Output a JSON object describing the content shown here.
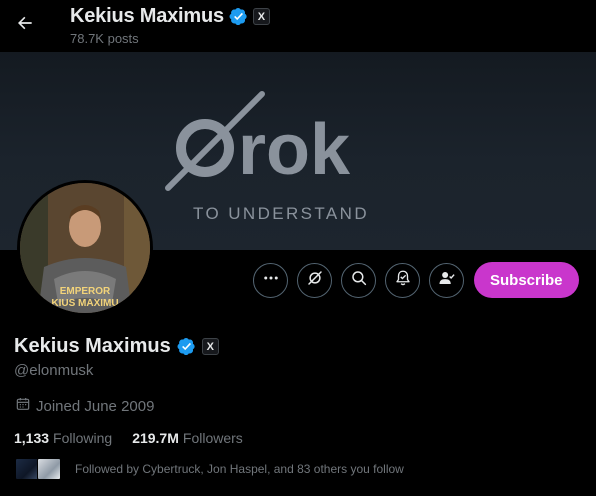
{
  "header": {
    "name": "Kekius Maximus",
    "posts": "78.7K posts",
    "badge_letter": "X"
  },
  "banner": {
    "logo_text": "rok",
    "tagline": "TO UNDERSTAND"
  },
  "avatar": {
    "caption_line1": "EMPEROR",
    "caption_line2": "KIUS MAXIMU"
  },
  "actions": {
    "icons": [
      "more-icon",
      "grok-icon",
      "search-icon",
      "notify-bell-icon",
      "following-icon"
    ],
    "subscribe_label": "Subscribe",
    "subscribe_color": "#c936cc"
  },
  "profile": {
    "name": "Kekius Maximus",
    "badge_letter": "X",
    "handle": "@elonmusk",
    "joined": "Joined June 2009"
  },
  "stats": {
    "following_count": "1,133",
    "following_label": "Following",
    "followers_count": "219.7M",
    "followers_label": "Followers"
  },
  "followed_by": {
    "text": "Followed by Cybertruck, Jon Haspel, and 83 others you follow"
  },
  "colors": {
    "verified_blue": "#1d9bf0",
    "muted_text": "#71767b",
    "primary_text": "#e7e9ea"
  }
}
